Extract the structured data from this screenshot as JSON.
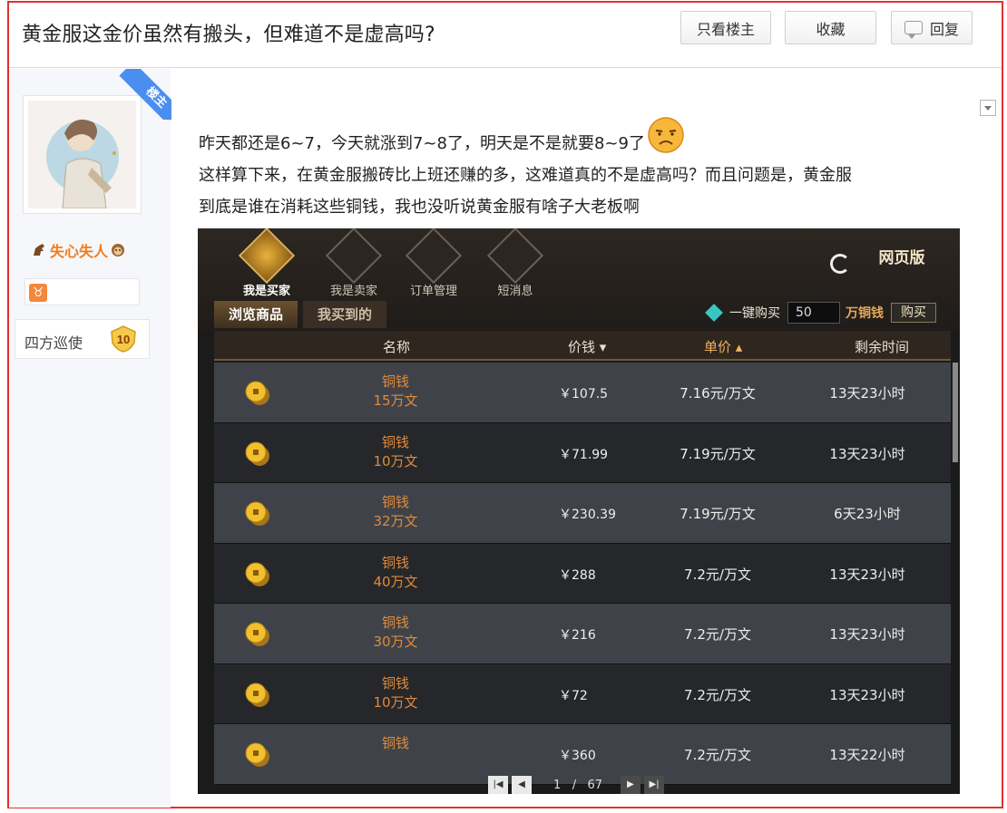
{
  "post": {
    "title": "黄金服这金价虽然有搬头，但难道不是虚高吗?",
    "buttons": {
      "only_owner": "只看楼主",
      "favorite": "收藏",
      "reply": "回复"
    },
    "body_lines": [
      "昨天都还是6~7，今天就涨到7~8了，明天是不是就要8~9了",
      "这样算下来，在黄金服搬砖比上班还赚的多，这难道真的不是虚高吗？而且问题是，黄金服",
      "到底是谁在消耗这些铜钱，我也没听说黄金服有啥子大老板啊"
    ],
    "owner_tag": "楼主"
  },
  "author": {
    "name": "失心失人",
    "rank_title": "四方巡使",
    "level": "10",
    "zodiac_icon": "taurus-icon"
  },
  "game": {
    "tabs": [
      "我是买家",
      "我是卖家",
      "订单管理",
      "短消息"
    ],
    "web_version": "网页版",
    "subtabs": [
      "浏览商品",
      "我买到的"
    ],
    "quick_buy": {
      "label": "一键购买",
      "qty": "50",
      "unit": "万铜钱",
      "buy": "购买"
    },
    "columns": {
      "name": "名称",
      "price": "价钱",
      "unit_price": "单价",
      "remaining": "剩余时间"
    },
    "rows": [
      {
        "item": "铜钱",
        "amount": "15万文",
        "price": "￥107.5",
        "unit_price": "7.16元/万文",
        "remaining": "13天23小时"
      },
      {
        "item": "铜钱",
        "amount": "10万文",
        "price": "￥71.99",
        "unit_price": "7.19元/万文",
        "remaining": "13天23小时"
      },
      {
        "item": "铜钱",
        "amount": "32万文",
        "price": "￥230.39",
        "unit_price": "7.19元/万文",
        "remaining": "6天23小时"
      },
      {
        "item": "铜钱",
        "amount": "40万文",
        "price": "￥288",
        "unit_price": "7.2元/万文",
        "remaining": "13天23小时"
      },
      {
        "item": "铜钱",
        "amount": "30万文",
        "price": "￥216",
        "unit_price": "7.2元/万文",
        "remaining": "13天23小时"
      },
      {
        "item": "铜钱",
        "amount": "10万文",
        "price": "￥72",
        "unit_price": "7.2元/万文",
        "remaining": "13天23小时"
      },
      {
        "item": "铜钱",
        "amount": "",
        "price": "￥360",
        "unit_price": "7.2元/万文",
        "remaining": "13天22小时"
      }
    ],
    "pager": {
      "current": "1",
      "sep": "/",
      "total": "67"
    }
  },
  "colors": {
    "frame": "#e0322f",
    "username": "#f27c1c",
    "owner_tag": "#4a8ef0",
    "coin_name": "#e08a3c"
  }
}
